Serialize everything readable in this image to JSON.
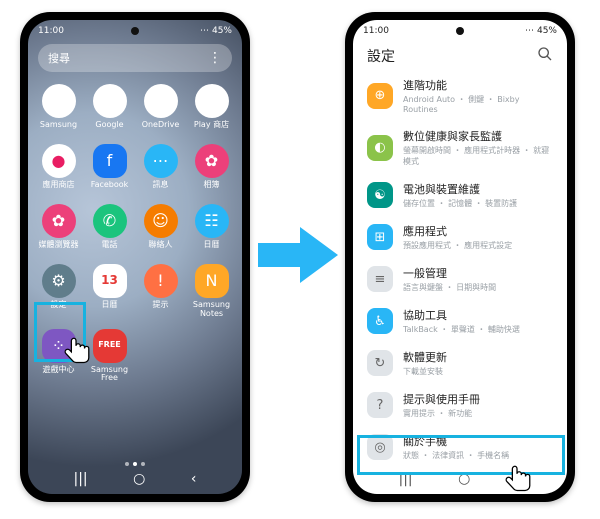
{
  "status": {
    "time": "11:00",
    "icons": "⋯",
    "battery": "45%",
    "camera_label": "▦"
  },
  "left": {
    "search_placeholder": "搜尋",
    "search_menu": "⋮",
    "apps": {
      "r1": [
        {
          "label": "Samsung",
          "glyph": "▦"
        },
        {
          "label": "Google",
          "glyph": "▦"
        },
        {
          "label": "OneDrive",
          "glyph": "☁"
        },
        {
          "label": "Play 商店",
          "glyph": "▶"
        }
      ],
      "r2": [
        {
          "label": "應用商店",
          "glyph": "●"
        },
        {
          "label": "Facebook",
          "glyph": "f"
        },
        {
          "label": "訊息",
          "glyph": "⋯"
        },
        {
          "label": "相簿",
          "glyph": "✿"
        }
      ],
      "r3": [
        {
          "label": "媒體瀏覽器",
          "glyph": "✿"
        },
        {
          "label": "電話",
          "glyph": "✆"
        },
        {
          "label": "聯絡人",
          "glyph": "☺"
        },
        {
          "label": "日曆",
          "glyph": "☷"
        }
      ],
      "r4": [
        {
          "label": "設定",
          "glyph": "⚙"
        },
        {
          "label": "日曆",
          "glyph": "13"
        },
        {
          "label": "提示",
          "glyph": "!"
        },
        {
          "label": "Samsung Notes",
          "glyph": "N"
        }
      ],
      "r5": [
        {
          "label": "遊戲中心",
          "glyph": "⁘"
        },
        {
          "label": "Samsung Free",
          "glyph": "FREE"
        }
      ]
    }
  },
  "right": {
    "title": "設定",
    "items": [
      {
        "title": "進階功能",
        "sub": "Android Auto ・ 側鍵 ・ Bixby Routines",
        "glyph": "⊕",
        "color": "c-yellow"
      },
      {
        "title": "數位健康與家長監護",
        "sub": "螢幕開啟時間 ・ 應用程式計時器 ・ 就寢模式",
        "glyph": "◐",
        "color": "c-lime"
      },
      {
        "title": "電池與裝置維護",
        "sub": "儲存位置 ・ 記憶體 ・ 裝置防護",
        "glyph": "☯",
        "color": "c-teal"
      },
      {
        "title": "應用程式",
        "sub": "預設應用程式 ・ 應用程式設定",
        "glyph": "⊞",
        "color": "c-blue"
      },
      {
        "title": "一般管理",
        "sub": "語言與鍵盤 ・ 日期與時間",
        "glyph": "≡",
        "color": "c-ltgrey"
      },
      {
        "title": "協助工具",
        "sub": "TalkBack ・ 單聲道 ・ 輔助快選",
        "glyph": "♿",
        "color": "c-blue"
      },
      {
        "title": "軟體更新",
        "sub": "下載並安裝",
        "glyph": "↻",
        "color": "c-ltgrey"
      },
      {
        "title": "提示與使用手冊",
        "sub": "實用提示 ・ 新功能",
        "glyph": "?",
        "color": "c-ltgrey"
      },
      {
        "title": "關於手機",
        "sub": "狀態 ・ 法律資訊 ・ 手機名稱",
        "glyph": "◎",
        "color": "c-ltgrey"
      }
    ]
  },
  "nav": {
    "recent": "|||",
    "home": "○",
    "back": "‹"
  }
}
